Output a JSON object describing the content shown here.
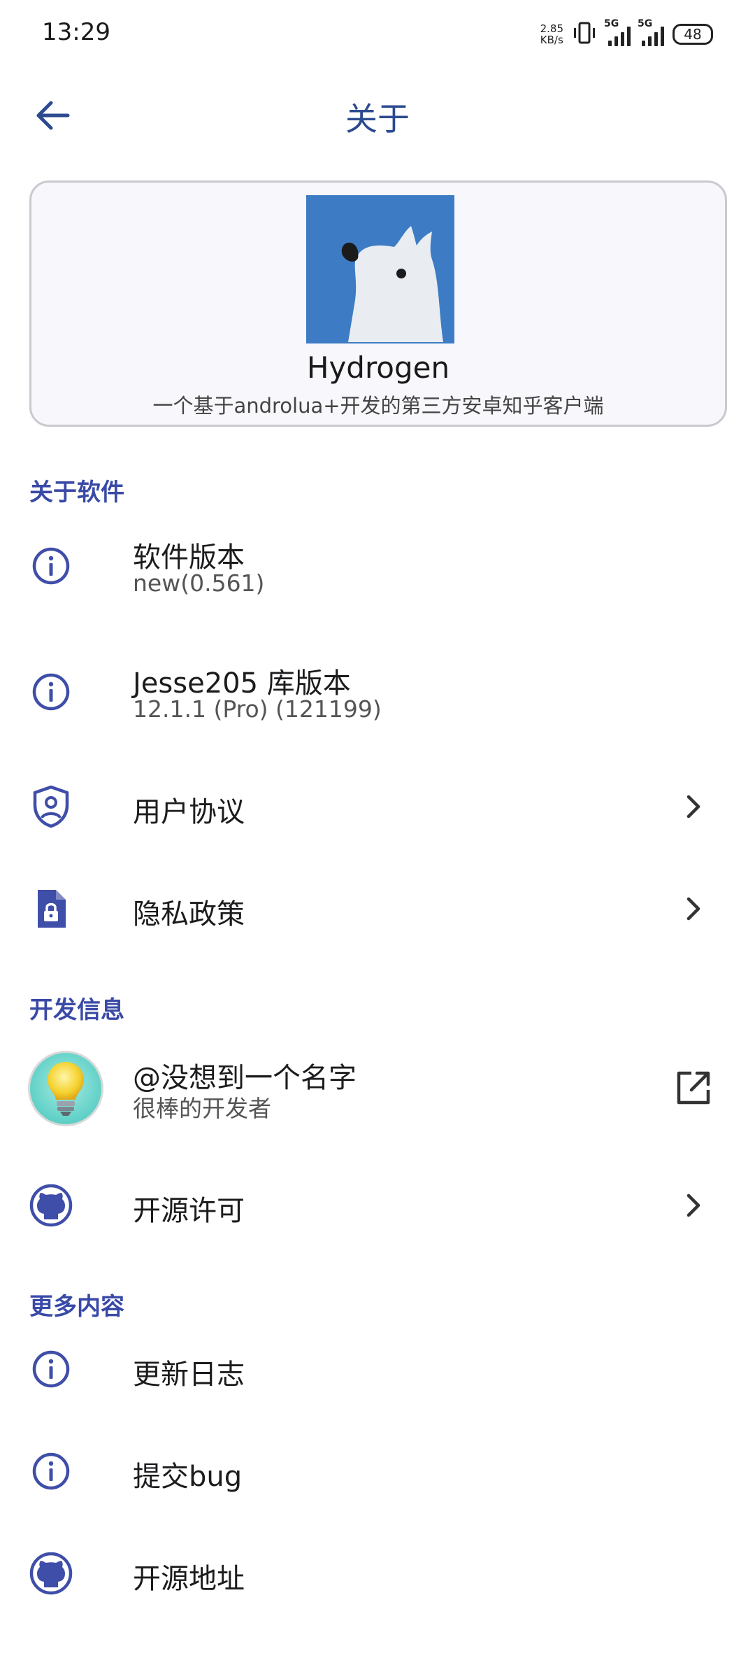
{
  "status_bar": {
    "time": "13:29",
    "net_speed_value": "2.85",
    "net_speed_unit": "KB/s",
    "sim1_label": "5G",
    "sim2_label": "5G",
    "battery": "48"
  },
  "app_bar": {
    "title": "关于",
    "back_icon": "arrow-back-icon"
  },
  "header": {
    "app_name": "Hydrogen",
    "description": "一个基于androlua+开发的第三方安卓知乎客户端",
    "logo_colors": {
      "background": "#3d7cc4",
      "dog": "#e9edf2"
    }
  },
  "sections": {
    "about_software": "关于软件",
    "dev_info": "开发信息",
    "more": "更多内容"
  },
  "items": {
    "version": {
      "title": "软件版本",
      "subtitle": "new(0.561)",
      "icon": "info-icon"
    },
    "lib_version": {
      "title": "Jesse205 库版本",
      "subtitle": "12.1.1 (Pro) (121199)",
      "icon": "info-icon"
    },
    "user_agreement": {
      "title": "用户协议",
      "icon": "shield-person-icon",
      "trail": "chevron-right-icon"
    },
    "privacy": {
      "title": "隐私政策",
      "icon": "document-lock-icon",
      "trail": "chevron-right-icon"
    },
    "developer": {
      "title": "@没想到一个名字",
      "subtitle": "很棒的开发者",
      "icon": "lightbulb-avatar",
      "trail": "open-external-icon"
    },
    "open_source_license": {
      "title": "开源许可",
      "icon": "github-icon",
      "trail": "chevron-right-icon"
    },
    "changelog": {
      "title": "更新日志",
      "icon": "info-icon"
    },
    "report_bug": {
      "title": "提交bug",
      "icon": "info-icon"
    },
    "source_address": {
      "title": "开源地址",
      "icon": "github-icon"
    }
  },
  "colors": {
    "accent": "#3949a6",
    "title": "#2c4a8f",
    "icon": "#3f4ea8"
  }
}
